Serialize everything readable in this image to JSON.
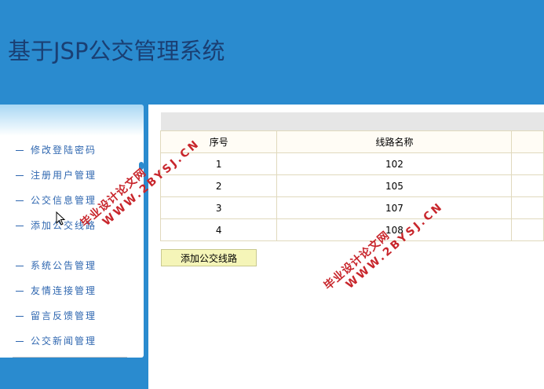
{
  "header": {
    "title": "基于JSP公交管理系统"
  },
  "sidebar": {
    "items": [
      {
        "label": "修改登陆密码"
      },
      {
        "label": "注册用户管理"
      },
      {
        "label": "公交信息管理"
      },
      {
        "label": "添加公交线路"
      },
      {
        "label": "系统公告管理"
      },
      {
        "label": "友情连接管理"
      },
      {
        "label": "留言反馈管理"
      },
      {
        "label": "公交新闻管理"
      }
    ]
  },
  "table": {
    "headers": [
      "序号",
      "线路名称",
      ""
    ],
    "rows": [
      [
        "1",
        "102",
        ""
      ],
      [
        "2",
        "105",
        ""
      ],
      [
        "3",
        "107",
        ""
      ],
      [
        "4",
        "108",
        ""
      ]
    ]
  },
  "actions": {
    "add_route": "添加公交线路"
  },
  "watermark": {
    "line1": "毕业设计论文网",
    "line2": "WWW.2BYSJ.CN"
  },
  "colors": {
    "header_bg": "#2a8bcf",
    "title": "#1a3f73",
    "menu_text": "#2f67b0",
    "watermark": "#c8262c",
    "button_bg": "#f5f5b8"
  }
}
